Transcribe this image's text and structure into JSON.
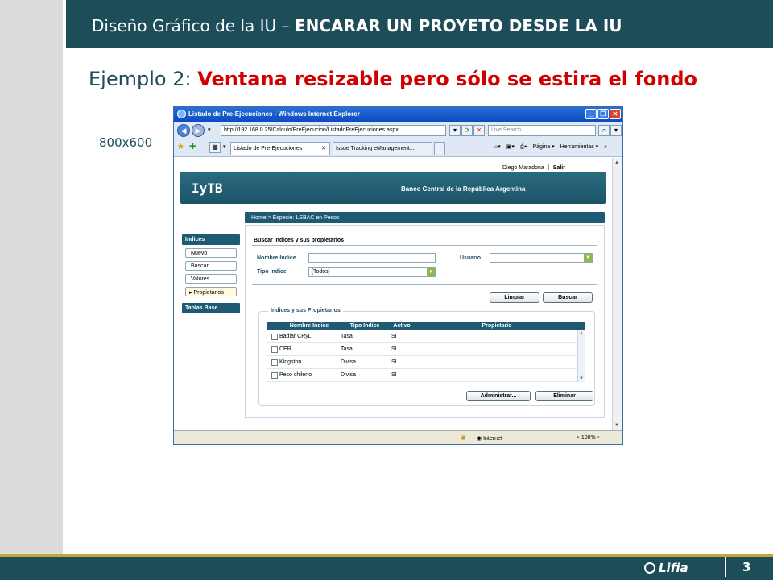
{
  "slide": {
    "header_prefix": "Diseño Gráfico de la IU – ",
    "header_bold": "ENCARAR UN PROYETO DESDE LA IU",
    "subtitle_prefix": "Ejemplo 2: ",
    "subtitle_red": "Ventana resizable pero sólo se estira el fondo",
    "size_label": "800x600",
    "footer_logo": "Lifia",
    "page_number": "3"
  },
  "browser": {
    "title": "Listado de Pre-Ejecuciones - Windows Internet Explorer",
    "url": "http://192.168.0.25/Calculo/PreEjecucion/ListadoPreEjecuciones.aspx",
    "search_placeholder": "Live Search",
    "tabs": [
      "Listado de Pre-Ejecuciones",
      "Issue Tracking eManagement..."
    ],
    "commands": [
      "Página ▾",
      "Herramientas ▾"
    ],
    "status_zone": "Internet",
    "zoom": "100%"
  },
  "app": {
    "user": "Diego Maradona",
    "logout": "Salir",
    "logo": "IyTB",
    "bank": "Banco Central de la República Argentina",
    "nav_header": "Indices",
    "nav_items": [
      "Nuevo",
      "Buscar",
      "Valores",
      "Propietarios"
    ],
    "nav_header2": "Tablas Base",
    "breadcrumb": "Home > Especie: LEBAC en Pesos",
    "section_title": "Buscar indices y sus propietarios",
    "label_nombre": "Nombre Indice",
    "label_usuario": "Usuario",
    "label_tipo": "Tipo Indice",
    "tipo_value": "[Todos]",
    "btn_limpiar": "Limpiar",
    "btn_buscar": "Buscar",
    "fieldset_title": "Indices y sus Propietarios",
    "columns": [
      "Nombre Indice",
      "Tipo Indice",
      "Activo",
      "Propietario"
    ],
    "rows": [
      {
        "name": "Badlar CRyL",
        "type": "Tasa",
        "active": "SI",
        "owner": ""
      },
      {
        "name": "CER",
        "type": "Tasa",
        "active": "SI",
        "owner": ""
      },
      {
        "name": "Kingston",
        "type": "Divisa",
        "active": "SI",
        "owner": ""
      },
      {
        "name": "Peso chileno",
        "type": "Divisa",
        "active": "SI",
        "owner": ""
      }
    ],
    "btn_administrar": "Administrar...",
    "btn_eliminar": "Eliminar"
  },
  "colors": {
    "brand_dark": "#1e4d5a",
    "accent_red": "#d00000",
    "gold_rule": "#c8a23a"
  }
}
